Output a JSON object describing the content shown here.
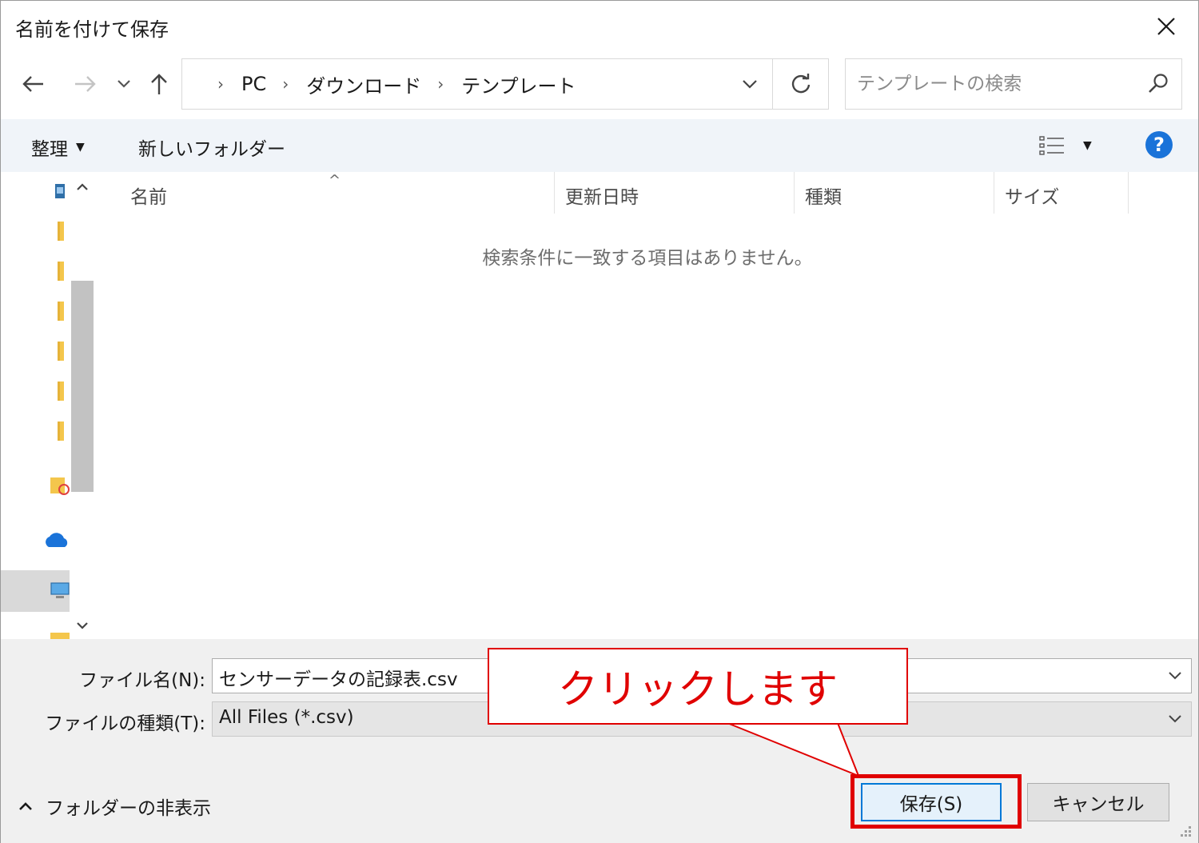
{
  "window": {
    "title": "名前を付けて保存"
  },
  "navigation": {
    "breadcrumbs": [
      "PC",
      "ダウンロード",
      "テンプレート"
    ]
  },
  "search": {
    "placeholder": "テンプレートの検索"
  },
  "toolbar": {
    "organize_label": "整理",
    "new_folder_label": "新しいフォルダー"
  },
  "file_list": {
    "columns": [
      "名前",
      "更新日時",
      "種類",
      "サイズ"
    ],
    "empty_message": "検索条件に一致する項目はありません。"
  },
  "form": {
    "filename_label": "ファイル名(N):",
    "filename_value": "センサーデータの記録表.csv",
    "filetype_label": "ファイルの種類(T):",
    "filetype_value": "All Files (*.csv)"
  },
  "footer": {
    "hide_folders_label": "フォルダーの非表示",
    "save_label": "保存(S)",
    "cancel_label": "キャンセル"
  },
  "annotation": {
    "callout_text": "クリックします",
    "color": "#e00000"
  },
  "colors": {
    "accent": "#0078d7",
    "help": "#1a73d9",
    "toolbar_bg": "#f0f4f9",
    "footer_bg": "#f0f0f0"
  }
}
